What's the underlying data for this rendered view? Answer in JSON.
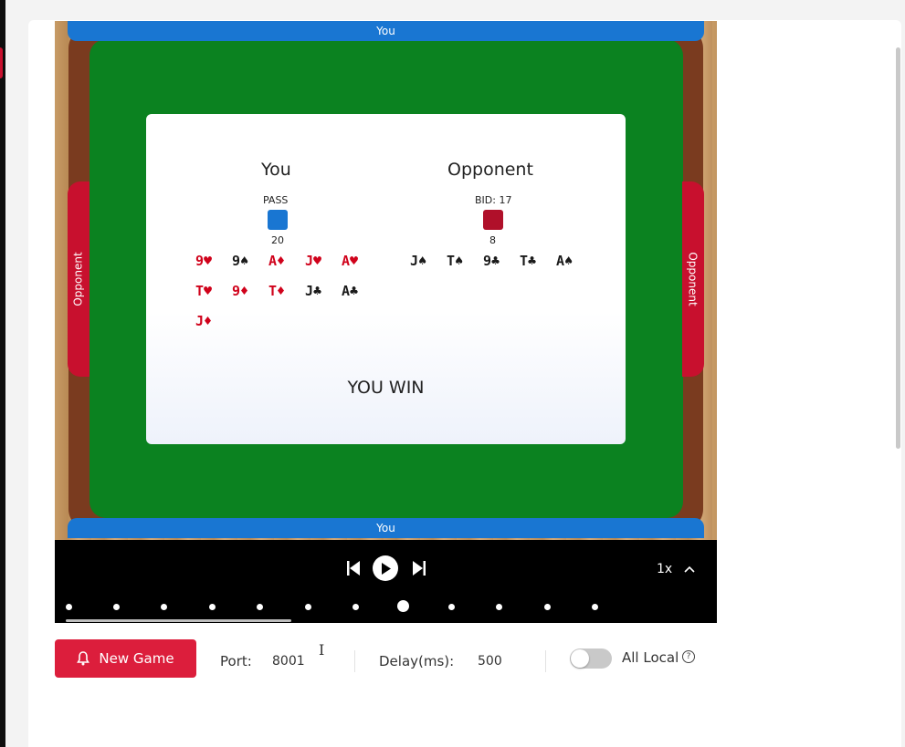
{
  "game": {
    "top_banner": "You",
    "bottom_banner": "You",
    "left_tab": "Opponent",
    "right_tab": "Opponent"
  },
  "result": {
    "outcome": "YOU WIN",
    "players": [
      {
        "name": "You",
        "status": "PASS",
        "chip_color": "#1976d2",
        "score": "20",
        "cards": [
          {
            "text": "9♥",
            "suit": "red"
          },
          {
            "text": "9♠",
            "suit": "black"
          },
          {
            "text": "A♦",
            "suit": "red"
          },
          {
            "text": "J♥",
            "suit": "red"
          },
          {
            "text": "A♥",
            "suit": "red"
          },
          {
            "text": "T♥",
            "suit": "red"
          },
          {
            "text": "9♦",
            "suit": "red"
          },
          {
            "text": "T♦",
            "suit": "red"
          },
          {
            "text": "J♣",
            "suit": "black"
          },
          {
            "text": "A♣",
            "suit": "black"
          },
          {
            "text": "J♦",
            "suit": "red"
          }
        ]
      },
      {
        "name": "Opponent",
        "status": "BID: 17",
        "chip_color": "#b0102a",
        "score": "8",
        "cards": [
          {
            "text": "J♠",
            "suit": "black"
          },
          {
            "text": "T♠",
            "suit": "black"
          },
          {
            "text": "9♣",
            "suit": "black"
          },
          {
            "text": "T♣",
            "suit": "black"
          },
          {
            "text": "A♠",
            "suit": "black"
          }
        ]
      }
    ]
  },
  "playback": {
    "speed": "1x",
    "step_count": 12,
    "active_step": 7,
    "progress_fraction": 0.34
  },
  "footer": {
    "new_game_label": "New Game",
    "port_label": "Port:",
    "port_value": "8001",
    "delay_label": "Delay(ms):",
    "delay_value": "500",
    "all_local_label": "All Local",
    "all_local_enabled": false
  },
  "colors": {
    "accent": "#dc1e3c",
    "felt": "#0b8220",
    "banner": "#1976d2"
  }
}
